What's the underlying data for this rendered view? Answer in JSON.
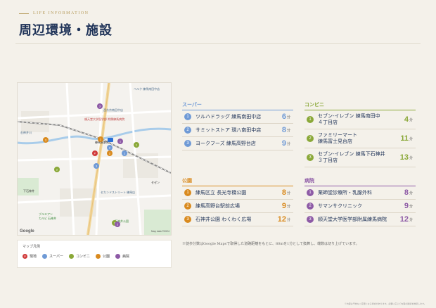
{
  "header": {
    "eyebrow": "LIFE INFORMATION",
    "title": "周辺環境・施設"
  },
  "map": {
    "labels": {
      "belc": "ベルク 練馬南田中店",
      "school": "西东京南田中店",
      "hospital": "順天堂大学医学部\n附属練馬病院",
      "shakujii": "石神井川",
      "nerima": "練馬高野台",
      "shimoshakujii": "下石神井",
      "secondst": "セカンドストリート 練馬店",
      "sezen": "セゼン",
      "aeon": "ブルエアン",
      "guide": "カルビ 石神井",
      "park": "石神井公園",
      "google": "Google",
      "copyright": "Map data ©2024"
    }
  },
  "legend": {
    "title": "マップ凡例",
    "items": [
      {
        "label": "現地",
        "color": "#d03a3a",
        "mark": "P"
      },
      {
        "label": "スーパー",
        "color": "#6f9ad6",
        "mark": ""
      },
      {
        "label": "コンビニ",
        "color": "#8aa838",
        "mark": ""
      },
      {
        "label": "公園",
        "color": "#d98a1e",
        "mark": ""
      },
      {
        "label": "病院",
        "color": "#8d5aa6",
        "mark": ""
      }
    ]
  },
  "sections": {
    "super": {
      "title": "スーパー",
      "color": "#6f9ad6",
      "items": [
        {
          "n": "1",
          "name": "ツルハドラッグ 練馬南田中店",
          "min": "6"
        },
        {
          "n": "2",
          "name": "サミットストア 環八南田中店",
          "min": "8"
        },
        {
          "n": "3",
          "name": "ヨークフーズ 練馬高野台店",
          "min": "9"
        }
      ]
    },
    "conveni": {
      "title": "コンビニ",
      "color": "#8aa838",
      "items": [
        {
          "n": "1",
          "name": "セブン-イレブン 練馬南田中\n４丁目店",
          "min": "4"
        },
        {
          "n": "2",
          "name": "ファミリーマート\n練馬富士見台店",
          "min": "11"
        },
        {
          "n": "3",
          "name": "セブン-イレブン 練馬下石神井\n３丁目店",
          "min": "13"
        }
      ]
    },
    "park": {
      "title": "公園",
      "color": "#d98a1e",
      "items": [
        {
          "n": "1",
          "name": "練馬区立 長光寺橋公園",
          "min": "8"
        },
        {
          "n": "2",
          "name": "練馬高野台駅前広場",
          "min": "9"
        },
        {
          "n": "3",
          "name": "石神井公園 わくわく広場",
          "min": "12"
        }
      ]
    },
    "hospital": {
      "title": "病院",
      "color": "#8d5aa6",
      "items": [
        {
          "n": "1",
          "name": "薬師堂診療所・乳腺外科",
          "min": "8"
        },
        {
          "n": "2",
          "name": "サマンサクリニック",
          "min": "9"
        },
        {
          "n": "3",
          "name": "順天堂大学医学部附属練馬病院",
          "min": "12"
        }
      ]
    }
  },
  "unit": "分",
  "note": "※徒歩分数はGoogle Mapsで取得した道路距離をもとに、80mを1分として換算し、端数は切り上げています。",
  "footnote": "※内容は予告なく変更となる場合があります。必要に応じて内容の確認を推奨します。"
}
